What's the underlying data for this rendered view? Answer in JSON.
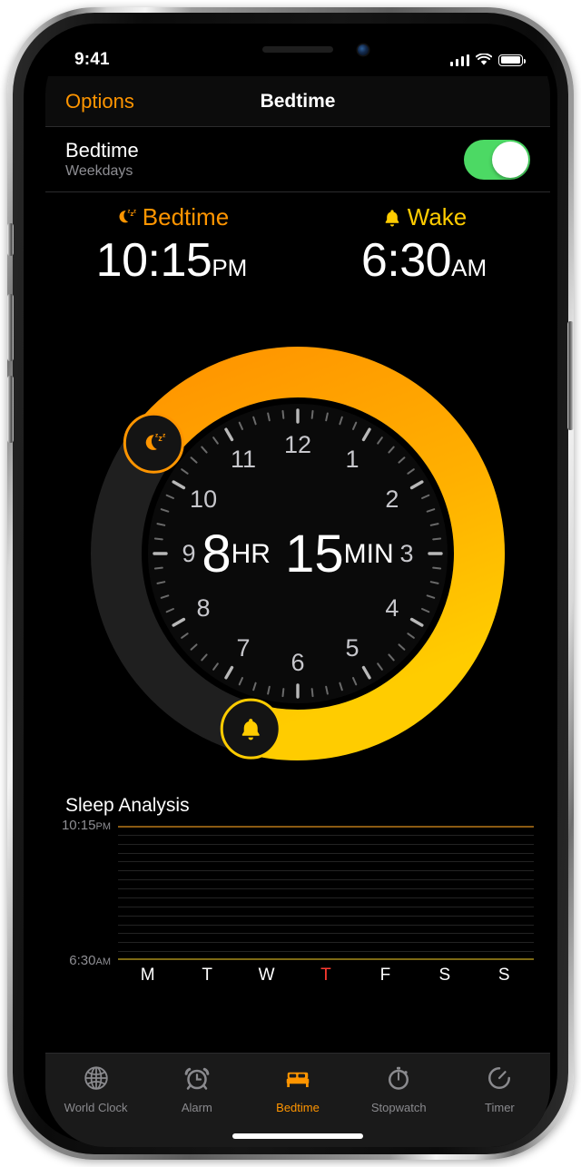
{
  "status_bar": {
    "time": "9:41",
    "signal_icon": "cellular-signal-icon",
    "wifi_icon": "wifi-icon",
    "battery_icon": "battery-full-icon"
  },
  "nav": {
    "left_button": "Options",
    "title": "Bedtime"
  },
  "toggle_row": {
    "title": "Bedtime",
    "subtitle": "Weekdays",
    "switch_on": true,
    "switch_color": "#4CD964"
  },
  "schedule": {
    "bedtime": {
      "label": "Bedtime",
      "icon": "moon-zzz-icon",
      "color": "#FF9500",
      "time": "10:15",
      "meridiem": "PM"
    },
    "wake": {
      "label": "Wake",
      "icon": "bell-icon",
      "color": "#FFCC00",
      "time": "6:30",
      "meridiem": "AM"
    }
  },
  "dial": {
    "duration_hours": "8",
    "duration_hours_unit": "HR",
    "duration_minutes": "15",
    "duration_minutes_unit": "MIN",
    "hour_numbers": [
      "12",
      "1",
      "2",
      "3",
      "4",
      "5",
      "6",
      "7",
      "8",
      "9",
      "10",
      "11"
    ],
    "arc_start_color": "#FF9500",
    "arc_end_color": "#FFCC00",
    "track_color": "#1f1f1f",
    "bedtime_handle_icon": "moon-zzz-icon",
    "wake_handle_icon": "bell-icon",
    "bedtime_angle_deg": 307.5,
    "wake_angle_deg": 195.0
  },
  "analysis": {
    "title": "Sleep Analysis",
    "top_axis_time": "10:15",
    "top_axis_meridiem": "PM",
    "bottom_axis_time": "6:30",
    "bottom_axis_meridiem": "AM",
    "top_line_color": "#8a5a12",
    "bottom_line_color": "#7d6a14",
    "gridline_count": 14,
    "days": [
      {
        "label": "M",
        "today": false
      },
      {
        "label": "T",
        "today": false
      },
      {
        "label": "W",
        "today": false
      },
      {
        "label": "T",
        "today": true
      },
      {
        "label": "F",
        "today": false
      },
      {
        "label": "S",
        "today": false
      },
      {
        "label": "S",
        "today": false
      }
    ],
    "today_color": "#FF3B30"
  },
  "tabs": [
    {
      "label": "World Clock",
      "icon": "globe-icon",
      "active": false
    },
    {
      "label": "Alarm",
      "icon": "alarm-clock-icon",
      "active": false
    },
    {
      "label": "Bedtime",
      "icon": "bed-icon",
      "active": true
    },
    {
      "label": "Stopwatch",
      "icon": "stopwatch-icon",
      "active": false
    },
    {
      "label": "Timer",
      "icon": "timer-icon",
      "active": false
    }
  ],
  "home_indicator": "home-indicator"
}
